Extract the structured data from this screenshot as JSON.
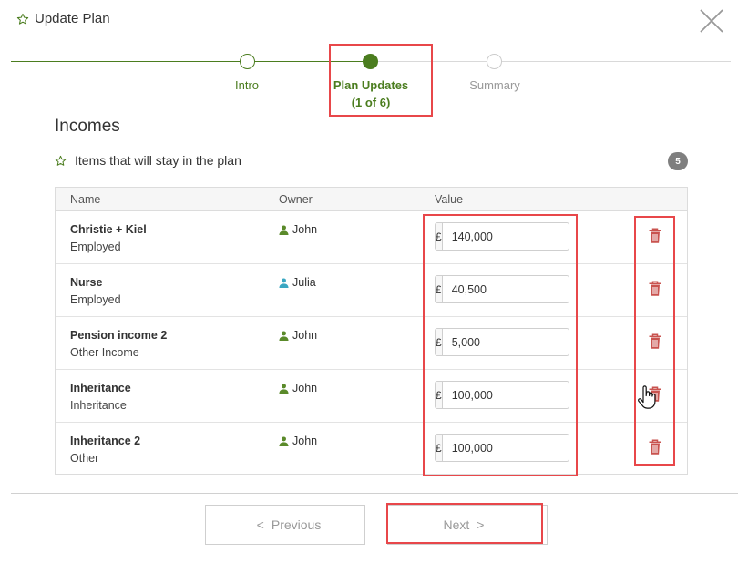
{
  "header": {
    "title": "Update Plan"
  },
  "stepper": {
    "steps": [
      {
        "label": "Intro",
        "state": "done"
      },
      {
        "label": "Plan Updates",
        "sub": "(1 of 6)",
        "state": "active"
      },
      {
        "label": "Summary",
        "state": "todo"
      }
    ]
  },
  "section": {
    "title": "Incomes",
    "subheader": "Items that will stay in the plan",
    "count": "5"
  },
  "table": {
    "columns": [
      "Name",
      "Owner",
      "Value"
    ],
    "currency": "£",
    "rows": [
      {
        "name": "Christie + Kiel",
        "type": "Employed",
        "owner": "John",
        "owner_color": "#5a8a2a",
        "value": "140,000"
      },
      {
        "name": "Nurse",
        "type": "Employed",
        "owner": "Julia",
        "owner_color": "#3aa7c2",
        "value": "40,500"
      },
      {
        "name": "Pension income 2",
        "type": "Other Income",
        "owner": "John",
        "owner_color": "#5a8a2a",
        "value": "5,000"
      },
      {
        "name": "Inheritance",
        "type": "Inheritance",
        "owner": "John",
        "owner_color": "#5a8a2a",
        "value": "100,000"
      },
      {
        "name": "Inheritance 2",
        "type": "Other",
        "owner": "John",
        "owner_color": "#5a8a2a",
        "value": "100,000"
      }
    ]
  },
  "footer": {
    "previous_label": "Previous",
    "next_label": "Next"
  },
  "colors": {
    "accent": "#4b7d1f",
    "highlight": "#e8474a",
    "trash": "#c9534f"
  }
}
